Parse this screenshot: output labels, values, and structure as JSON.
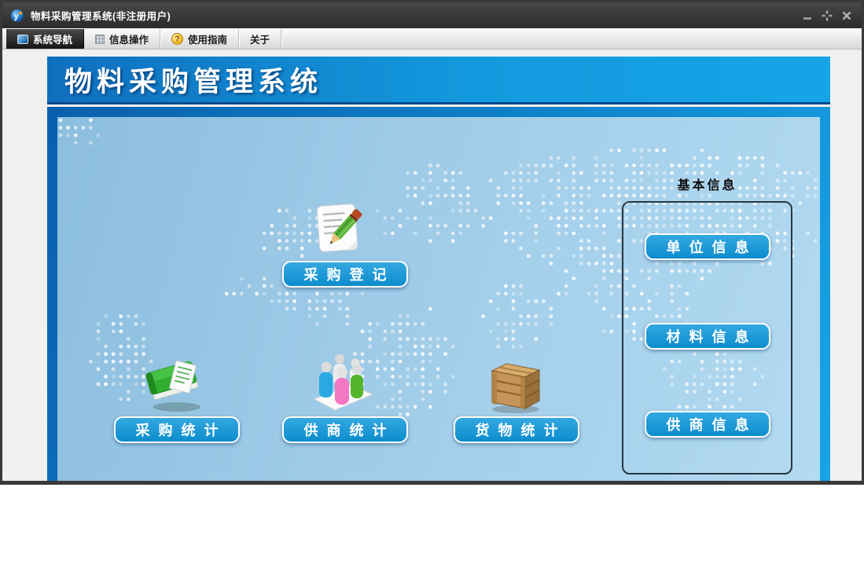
{
  "window": {
    "title": "物料采购管理系统(非注册用户)",
    "controls": [
      {
        "name": "minimize"
      },
      {
        "name": "restore"
      },
      {
        "name": "close"
      }
    ]
  },
  "tabs": [
    {
      "label": "系统导航",
      "icon": "screen-icon",
      "active": true
    },
    {
      "label": "信息操作",
      "icon": "grid-icon",
      "active": false
    },
    {
      "label": "使用指南",
      "icon": "help-icon",
      "active": false
    },
    {
      "label": "关于",
      "icon": "none",
      "active": false
    }
  ],
  "help_icon_glyph": "?",
  "banner": {
    "title": "物料采购管理系统"
  },
  "main": {
    "features": [
      {
        "label": "采购登记",
        "icon": "notepad-pencil-icon"
      },
      {
        "label": "采购统计",
        "icon": "green-book-icon"
      },
      {
        "label": "供商统计",
        "icon": "people-group-icon"
      },
      {
        "label": "货物统计",
        "icon": "wooden-crate-icon"
      }
    ],
    "basic_info": {
      "title": "基本信息",
      "buttons": [
        {
          "label": "单位信息"
        },
        {
          "label": "材料信息"
        },
        {
          "label": "供商信息"
        }
      ]
    }
  },
  "colors": {
    "button_blue": "#0e8ed2",
    "banner_blue_left": "#0f6fbe",
    "banner_blue_right": "#15a5e6",
    "frame_blue": "#0a5fae",
    "panel_blue": "#a2cde9",
    "titlebar_gray": "#333333",
    "dot_white": "#ffffff"
  }
}
